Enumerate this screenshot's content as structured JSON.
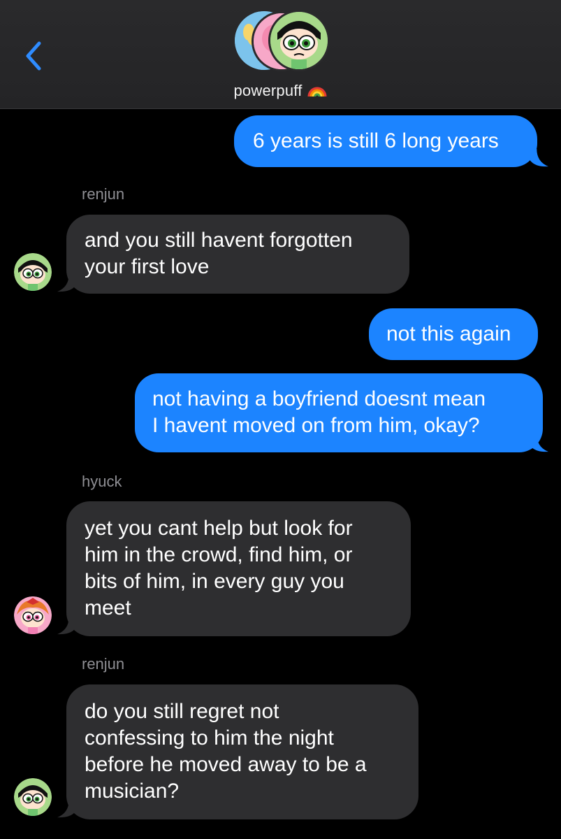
{
  "header": {
    "title": "powerpuff",
    "title_emoji": "rainbow-emoji",
    "back_icon": "chevron-left-icon",
    "avatars": [
      "blue-avatar",
      "pink-avatar",
      "green-avatar"
    ]
  },
  "colors": {
    "outgoing": "#1c84ff",
    "incoming": "#2e2e30",
    "background": "#000000",
    "back_chevron": "#2f8cff"
  },
  "messages": [
    {
      "direction": "out",
      "text": "6 years is still 6 long years"
    },
    {
      "direction": "in",
      "sender": "renjun",
      "avatar": "green-avatar",
      "text": "and you still havent forgotten\nyour first love"
    },
    {
      "direction": "out",
      "text": "not this again"
    },
    {
      "direction": "out",
      "text": "not having a boyfriend doesnt mean\nI havent moved on from him, okay?"
    },
    {
      "direction": "in",
      "sender": "hyuck",
      "avatar": "pink-avatar",
      "text": "yet you cant help but look for\nhim in the crowd, find him, or\nbits of him, in every guy you\nmeet"
    },
    {
      "direction": "in",
      "sender": "renjun",
      "avatar": "green-avatar",
      "text": "do you still regret not\nconfessing to him the night\nbefore he moved away to be a\nmusician?"
    }
  ]
}
